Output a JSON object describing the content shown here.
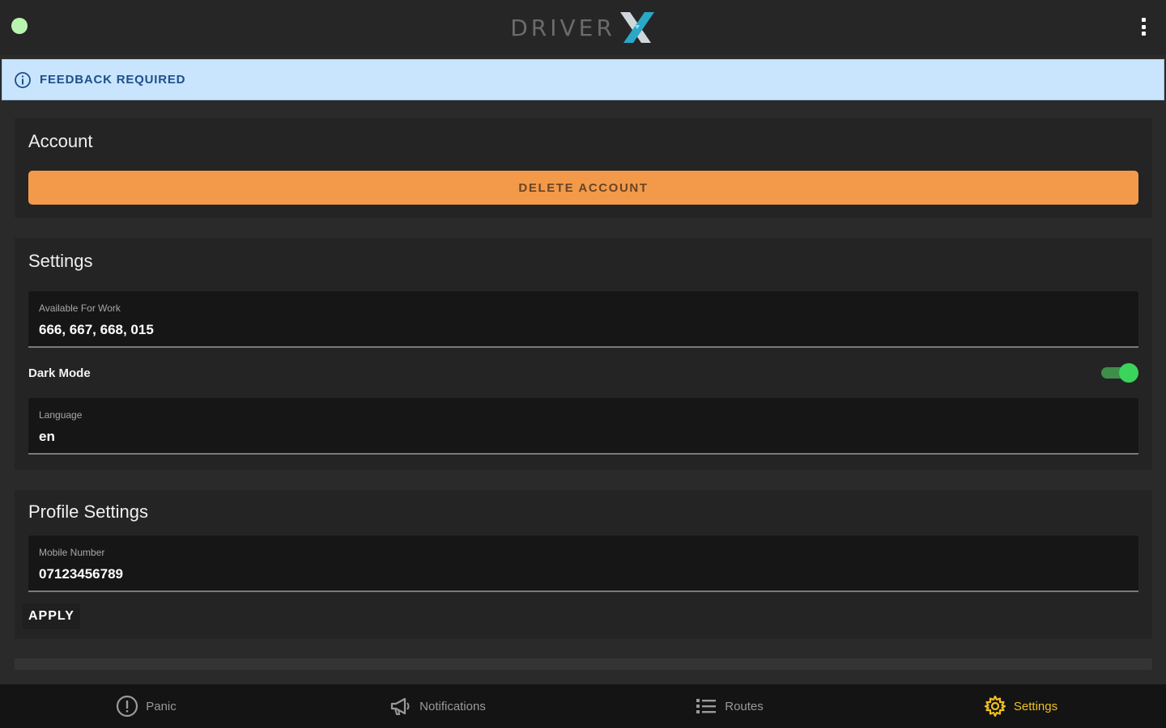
{
  "header": {
    "logo_text": "DRIVER",
    "logo_mark": "X"
  },
  "banner": {
    "text": "FEEDBACK REQUIRED"
  },
  "account": {
    "title": "Account",
    "delete_label": "DELETE ACCOUNT"
  },
  "settings": {
    "title": "Settings",
    "available_label": "Available For Work",
    "available_value": "666, 667, 668, 015",
    "dark_mode_label": "Dark Mode",
    "dark_mode_on": true,
    "language_label": "Language",
    "language_value": "en"
  },
  "profile": {
    "title": "Profile Settings",
    "mobile_label": "Mobile Number",
    "mobile_value": "07123456789",
    "apply_label": "APPLY"
  },
  "nav": {
    "items": [
      {
        "label": "Panic",
        "icon": "alert-circle-icon"
      },
      {
        "label": "Notifications",
        "icon": "megaphone-icon"
      },
      {
        "label": "Routes",
        "icon": "list-icon"
      },
      {
        "label": "Settings",
        "icon": "gear-icon"
      }
    ],
    "active": "Settings"
  },
  "colors": {
    "accent": "#f0c020",
    "delete": "#f39a4a",
    "toggle_on": "#3bd45a",
    "banner_bg": "#c9e4fd"
  }
}
